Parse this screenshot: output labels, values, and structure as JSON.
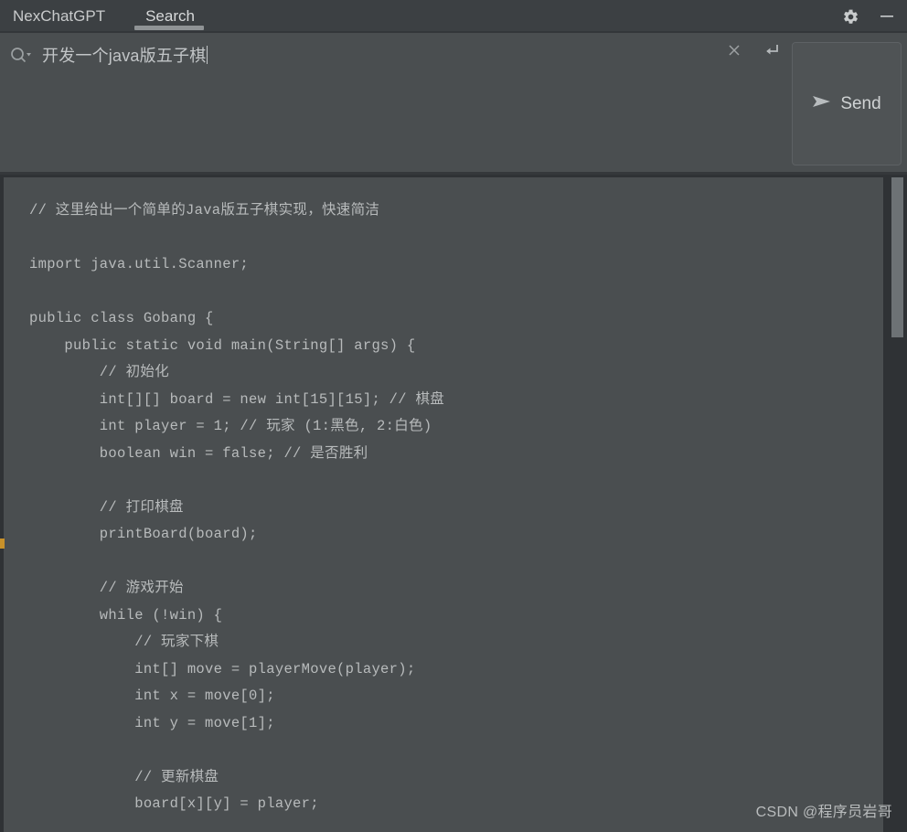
{
  "window": {
    "tabs": [
      {
        "label": "NexChatGPT",
        "active": false
      },
      {
        "label": "Search",
        "active": true
      }
    ],
    "controls": {
      "settings": "gear-icon",
      "minimize": "minimize-icon"
    }
  },
  "search": {
    "icon": "search-dropdown-icon",
    "value": "开发一个java版五子棋",
    "placeholder": "",
    "clear_icon": "close-icon",
    "enter_icon": "enter-return-icon"
  },
  "send": {
    "label": "Send",
    "icon": "send-plane-icon"
  },
  "response": {
    "code_lines": [
      "// 这里给出一个简单的Java版五子棋实现，快速简洁",
      "",
      "import java.util.Scanner;",
      "",
      "public class Gobang {",
      "    public static void main(String[] args) {",
      "        // 初始化",
      "        int[][] board = new int[15][15]; // 棋盘",
      "        int player = 1; // 玩家 (1:黑色, 2:白色)",
      "        boolean win = false; // 是否胜利",
      "",
      "        // 打印棋盘",
      "        printBoard(board);",
      "",
      "        // 游戏开始",
      "        while (!win) {",
      "            // 玩家下棋",
      "            int[] move = playerMove(player);",
      "            int x = move[0];",
      "            int y = move[1];",
      "",
      "            // 更新棋盘",
      "            board[x][y] = player;"
    ]
  },
  "watermark": {
    "text": "CSDN @程序员岩哥"
  },
  "colors": {
    "titlebar_bg": "#3c4043",
    "panel_bg": "#4a4e50",
    "outer_bg": "#2f3235",
    "text": "#c8cacb",
    "code_text": "#b8bbbc",
    "scrollbar_thumb": "#6d7275",
    "tab_underline": "#8f9395",
    "gutter_marker": "#c8912a"
  }
}
